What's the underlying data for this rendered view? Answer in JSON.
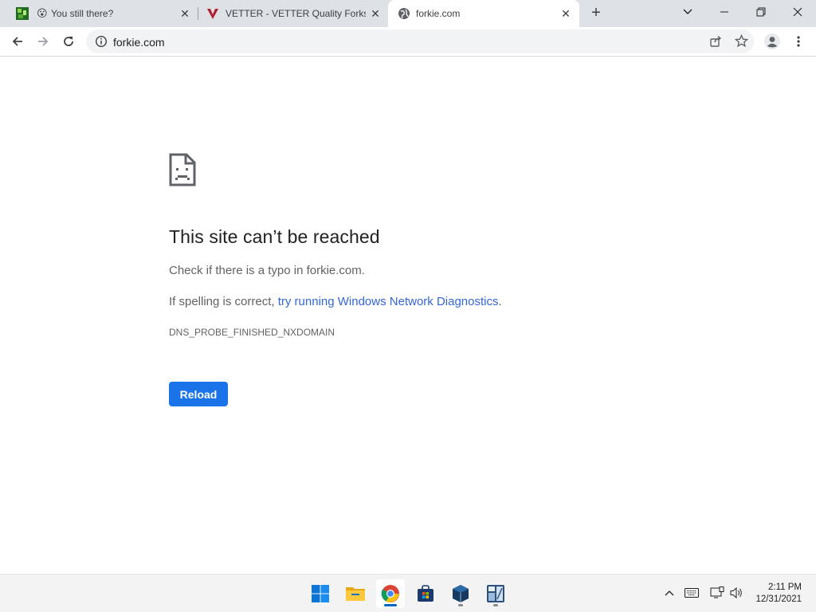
{
  "browser": {
    "tabs": [
      {
        "title": "You still there?",
        "favicon": "game-icon"
      },
      {
        "title": "VETTER - VETTER Quality Forks fo",
        "favicon": "vetter-icon"
      },
      {
        "title": "forkie.com",
        "favicon": "globe-icon",
        "active": true
      }
    ],
    "new_tab": "+",
    "address": "forkie.com"
  },
  "error_page": {
    "heading": "This site can’t be reached",
    "line1": "Check if there is a typo in forkie.com.",
    "line2_prefix": "If spelling is correct, ",
    "line2_link": "try running Windows Network Diagnostics",
    "line2_suffix": ".",
    "error_code": "DNS_PROBE_FINISHED_NXDOMAIN",
    "reload_label": "Reload"
  },
  "taskbar": {
    "apps": [
      "start-icon",
      "file-explorer-icon",
      "chrome-icon",
      "store-icon",
      "virtualbox-icon",
      "calculator-app-icon"
    ],
    "time": "2:11 PM",
    "date": "12/31/2021"
  },
  "colors": {
    "accent": "#1a73e8",
    "link": "#3367d6",
    "tabstrip": "#dee1e6",
    "taskbar": "#f3f3f3"
  }
}
